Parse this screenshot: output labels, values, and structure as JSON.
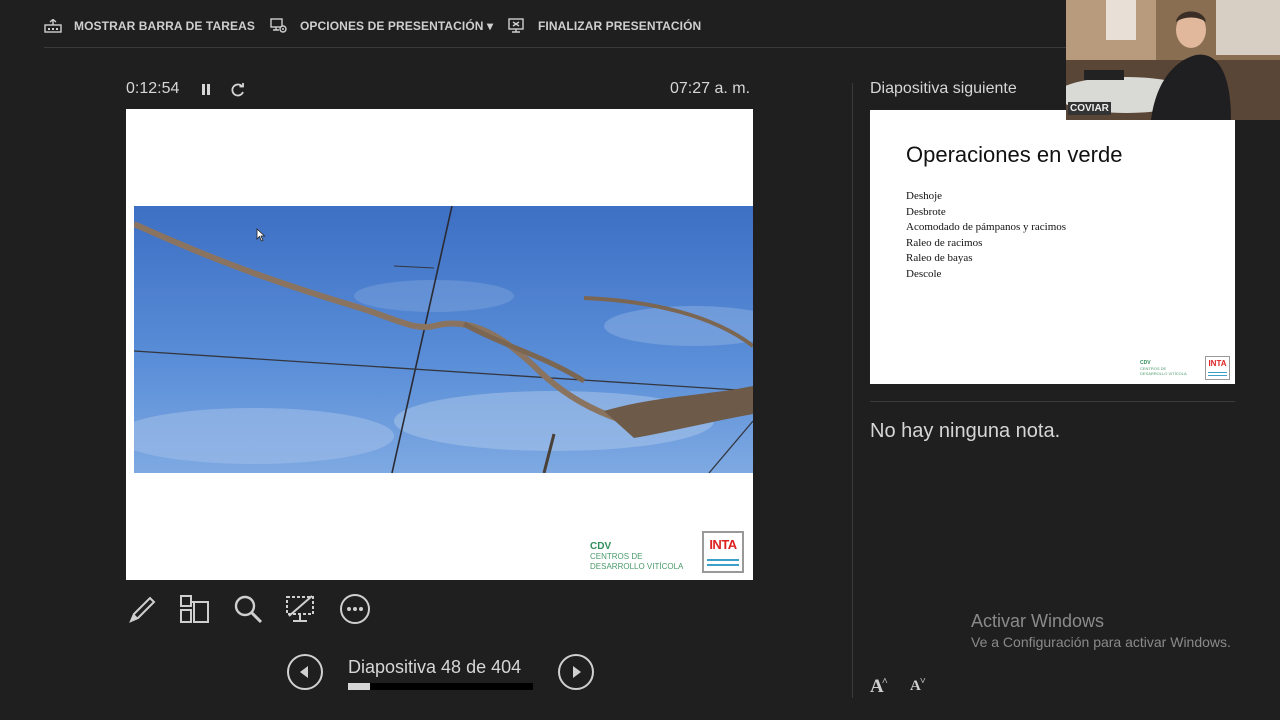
{
  "toolbar": {
    "taskbar_label": "MOSTRAR BARRA DE TAREAS",
    "options_label": "OPCIONES DE PRESENTACIÓN ▾",
    "end_label": "FINALIZAR PRESENTACIÓN"
  },
  "timer": {
    "elapsed": "0:12:54",
    "clock": "07:27 a. m."
  },
  "current_slide": {
    "logo_cdv": "CDV",
    "logo_line1": "CENTROS DE",
    "logo_line2": "DESARROLLO VITÍCOLA",
    "logo_inta": "INTA"
  },
  "navigation": {
    "slide_counter": "Diapositiva 48 de 404",
    "progress": 0.119
  },
  "next_slide": {
    "heading": "Diapositiva siguiente",
    "title": "Operaciones en verde",
    "bullets": [
      "Deshoje",
      "Desbrote",
      "Acomodado de pámpanos y racimos",
      "Raleo de racimos",
      "Raleo de bayas",
      "Descole"
    ],
    "logo_cdv": "CDV",
    "logo_line1": "CENTROS DE",
    "logo_line2": "DESARROLLO VITÍCOLA",
    "logo_inta": "INTA"
  },
  "notes": {
    "text": "No hay ninguna nota."
  },
  "font_controls": {
    "increase": "A",
    "decrease": "A"
  },
  "webcam": {
    "label": "COVIAR"
  },
  "watermark": {
    "title": "Activar Windows",
    "subtitle": "Ve a Configuración para activar Windows."
  }
}
